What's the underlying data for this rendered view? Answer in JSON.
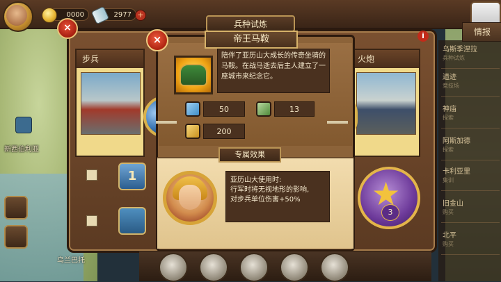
{
  "topbar": {
    "gold": "0000",
    "scrolls": "2977",
    "plus": "+"
  },
  "main": {
    "title": "兵种试炼",
    "close": "×",
    "info_button": "i",
    "left_unit": "步兵",
    "right_unit": "火炮",
    "level": "1",
    "star_count": "3"
  },
  "dialog": {
    "title": "帝王马鞍",
    "close": "×",
    "description": "陪伴了亚历山大成长的传奇坐骑的马鞍。在战马逝去后主人建立了一座城市来纪念它。",
    "stats": [
      {
        "icon": "sword-icon",
        "value": "50"
      },
      {
        "icon": "boot-icon",
        "value": "13"
      },
      {
        "icon": "horse-icon",
        "value": "200"
      }
    ],
    "exclusive_title": "专属效果",
    "effect_text_lines": [
      "亚历山大使用时:",
      "行军时将无视地形的影响,",
      "对步兵单位伤害+50%"
    ]
  },
  "map": {
    "city_label": "新西伯利亚",
    "bottom_label": "乌兰巴托"
  },
  "right_panel": {
    "tab": "情报",
    "items": [
      {
        "title": "乌斯季涅拉",
        "sub": "兵种试炼"
      },
      {
        "title": "遗迹",
        "sub": "竞技场"
      },
      {
        "title": "神庙",
        "sub": "探索"
      },
      {
        "title": "阿斯加德",
        "sub": "探索"
      },
      {
        "title": "卡利亚里",
        "sub": "集训"
      },
      {
        "title": "旧金山",
        "sub": "购买"
      },
      {
        "title": "北平",
        "sub": "购买"
      }
    ]
  },
  "colors": {
    "panel_brown": "#8c6339",
    "parchment": "#f2dcae",
    "close_red": "#ae2411",
    "gold": "#d7a438"
  }
}
